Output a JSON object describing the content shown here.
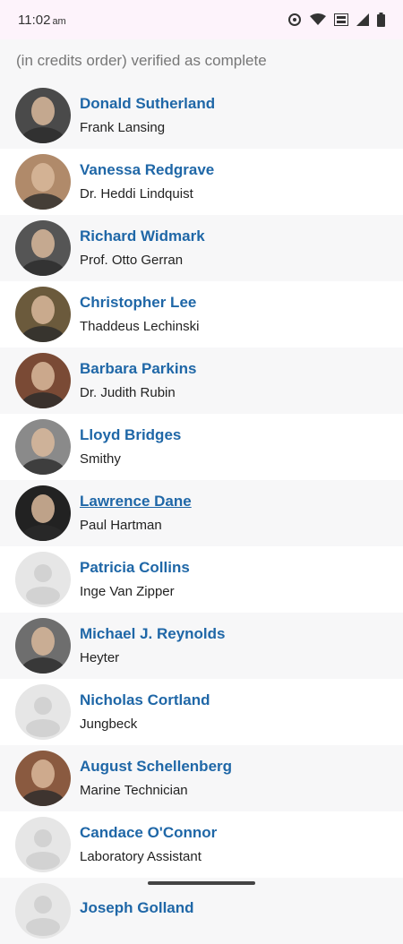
{
  "status": {
    "time": "11:02",
    "ampm": "am"
  },
  "header": {
    "text": "(in credits order) verified as complete"
  },
  "cast": [
    {
      "name": "Donald Sutherland",
      "role": "Frank Lansing",
      "has_photo": true,
      "tone": "#4a4a4a"
    },
    {
      "name": "Vanessa Redgrave",
      "role": "Dr. Heddi Lindquist",
      "has_photo": true,
      "tone": "#b08a6a"
    },
    {
      "name": "Richard Widmark",
      "role": "Prof. Otto Gerran",
      "has_photo": true,
      "tone": "#555555"
    },
    {
      "name": "Christopher Lee",
      "role": "Thaddeus Lechinski",
      "has_photo": true,
      "tone": "#6b5a3c"
    },
    {
      "name": "Barbara Parkins",
      "role": "Dr. Judith Rubin",
      "has_photo": true,
      "tone": "#7a4a35"
    },
    {
      "name": "Lloyd Bridges",
      "role": "Smithy",
      "has_photo": true,
      "tone": "#8a8a8a"
    },
    {
      "name": "Lawrence Dane",
      "role": "Paul Hartman",
      "has_photo": true,
      "tone": "#222222"
    },
    {
      "name": "Patricia Collins",
      "role": "Inge Van Zipper",
      "has_photo": false,
      "tone": "#e3e3e3"
    },
    {
      "name": "Michael J. Reynolds",
      "role": "Heyter",
      "has_photo": true,
      "tone": "#6e6e6e"
    },
    {
      "name": "Nicholas Cortland",
      "role": "Jungbeck",
      "has_photo": false,
      "tone": "#e3e3e3"
    },
    {
      "name": "August Schellenberg",
      "role": "Marine Technician",
      "has_photo": true,
      "tone": "#8a5a40"
    },
    {
      "name": "Candace O'Connor",
      "role": "Laboratory Assistant",
      "has_photo": false,
      "tone": "#e3e3e3"
    },
    {
      "name": "Joseph Golland",
      "role": "",
      "has_photo": false,
      "tone": "#e3e3e3"
    }
  ],
  "underlined_name": "Lawrence Dane"
}
